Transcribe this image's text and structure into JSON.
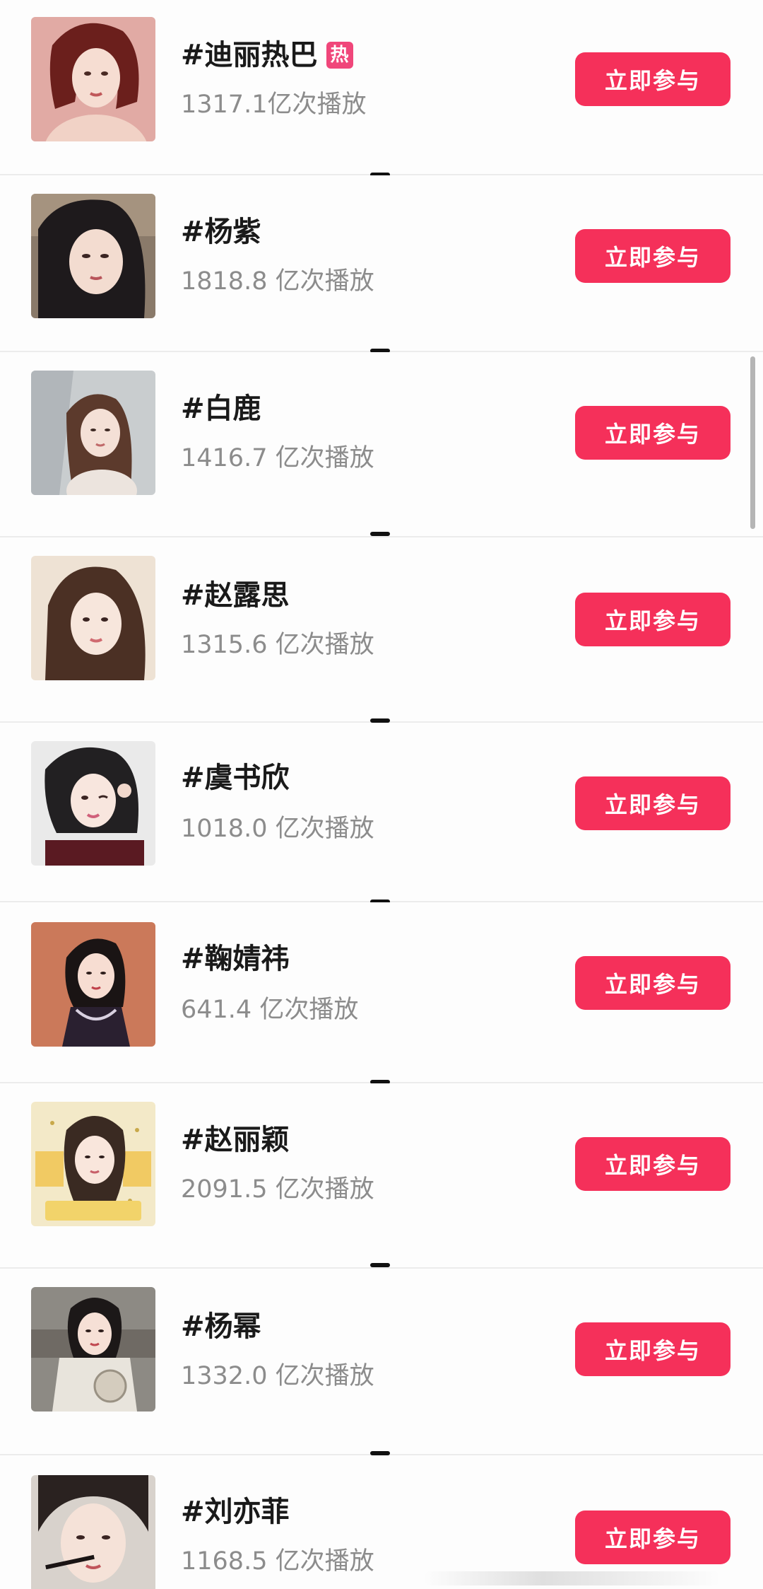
{
  "button_label": "立即参与",
  "hot_badge": "热",
  "accent_color": "#f5305a",
  "hot_badge_color": "#f0467a",
  "topics": [
    {
      "name": "#迪丽热巴",
      "plays": "1317.1亿次播放",
      "hot": true
    },
    {
      "name": "#杨紫",
      "plays": "1818.8 亿次播放",
      "hot": false
    },
    {
      "name": "#白鹿",
      "plays": "1416.7 亿次播放",
      "hot": false
    },
    {
      "name": "#赵露思",
      "plays": "1315.6 亿次播放",
      "hot": false
    },
    {
      "name": "#虞书欣",
      "plays": "1018.0 亿次播放",
      "hot": false
    },
    {
      "name": "#鞠婧祎",
      "plays": "641.4 亿次播放",
      "hot": false
    },
    {
      "name": "#赵丽颖",
      "plays": "2091.5 亿次播放",
      "hot": false
    },
    {
      "name": "#杨幂",
      "plays": "1332.0 亿次播放",
      "hot": false
    },
    {
      "name": "#刘亦菲",
      "plays": "1168.5 亿次播放",
      "hot": false
    }
  ],
  "thumbnail_icons": [
    "portrait-photo",
    "portrait-photo",
    "portrait-photo",
    "portrait-photo",
    "portrait-photo",
    "portrait-photo",
    "portrait-photo",
    "portrait-photo",
    "portrait-photo"
  ]
}
